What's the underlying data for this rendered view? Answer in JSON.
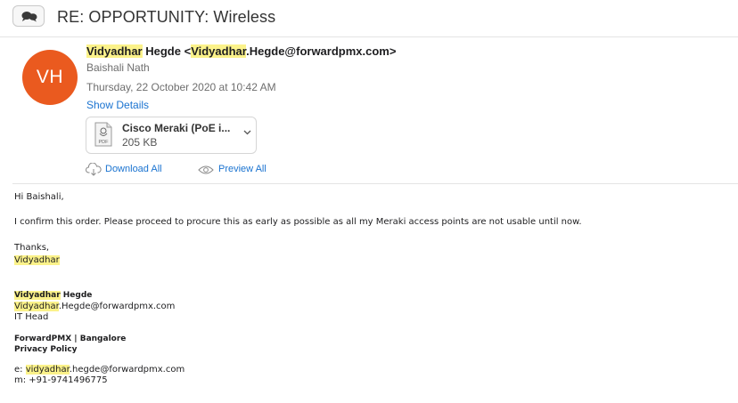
{
  "header": {
    "subject": "RE: OPPORTUNITY: Wireless",
    "thread_icon": "conversation-bubbles-icon"
  },
  "sender": {
    "initials": "VH",
    "avatar_color": "#ea5a1f",
    "first_name": "Vidyadhar",
    "last_name": " Hegde ",
    "email_prefix_open": "<",
    "email_hl": "Vidyadhar",
    "email_rest": ".Hegde@forwardpmx.com>",
    "to": "Baishali Nath",
    "date": "Thursday, 22 October 2020 at 10:42 AM",
    "show_details": "Show Details"
  },
  "attachment": {
    "name": "Cisco Meraki (PoE i...",
    "size": "205 KB",
    "icon": "pdf-file-icon",
    "icon_label": "PDF",
    "download_all": "Download All",
    "preview_all": "Preview All"
  },
  "message": {
    "greeting": "Hi Baishali,",
    "body": "I confirm this order. Please proceed to procure this as early as possible as all my Meraki access points are not usable until now.",
    "closing": "Thanks,",
    "closing_name": "Vidyadhar"
  },
  "signature": {
    "name_hl": "Vidyadhar",
    "name_rest": " Hegde",
    "email_hl": "Vidyadhar",
    "email_rest": ".Hegde@forwardpmx.com",
    "title": "IT Head",
    "company": "ForwardPMX  |  Bangalore",
    "privacy": "Privacy Policy",
    "e_label": "e: ",
    "e_hl": "vidyadhar",
    "e_rest": ".hegde@forwardpmx.com",
    "phone": "m: +91-9741496775"
  },
  "colors": {
    "highlight": "#fbf28a",
    "link": "#1a73d0"
  }
}
